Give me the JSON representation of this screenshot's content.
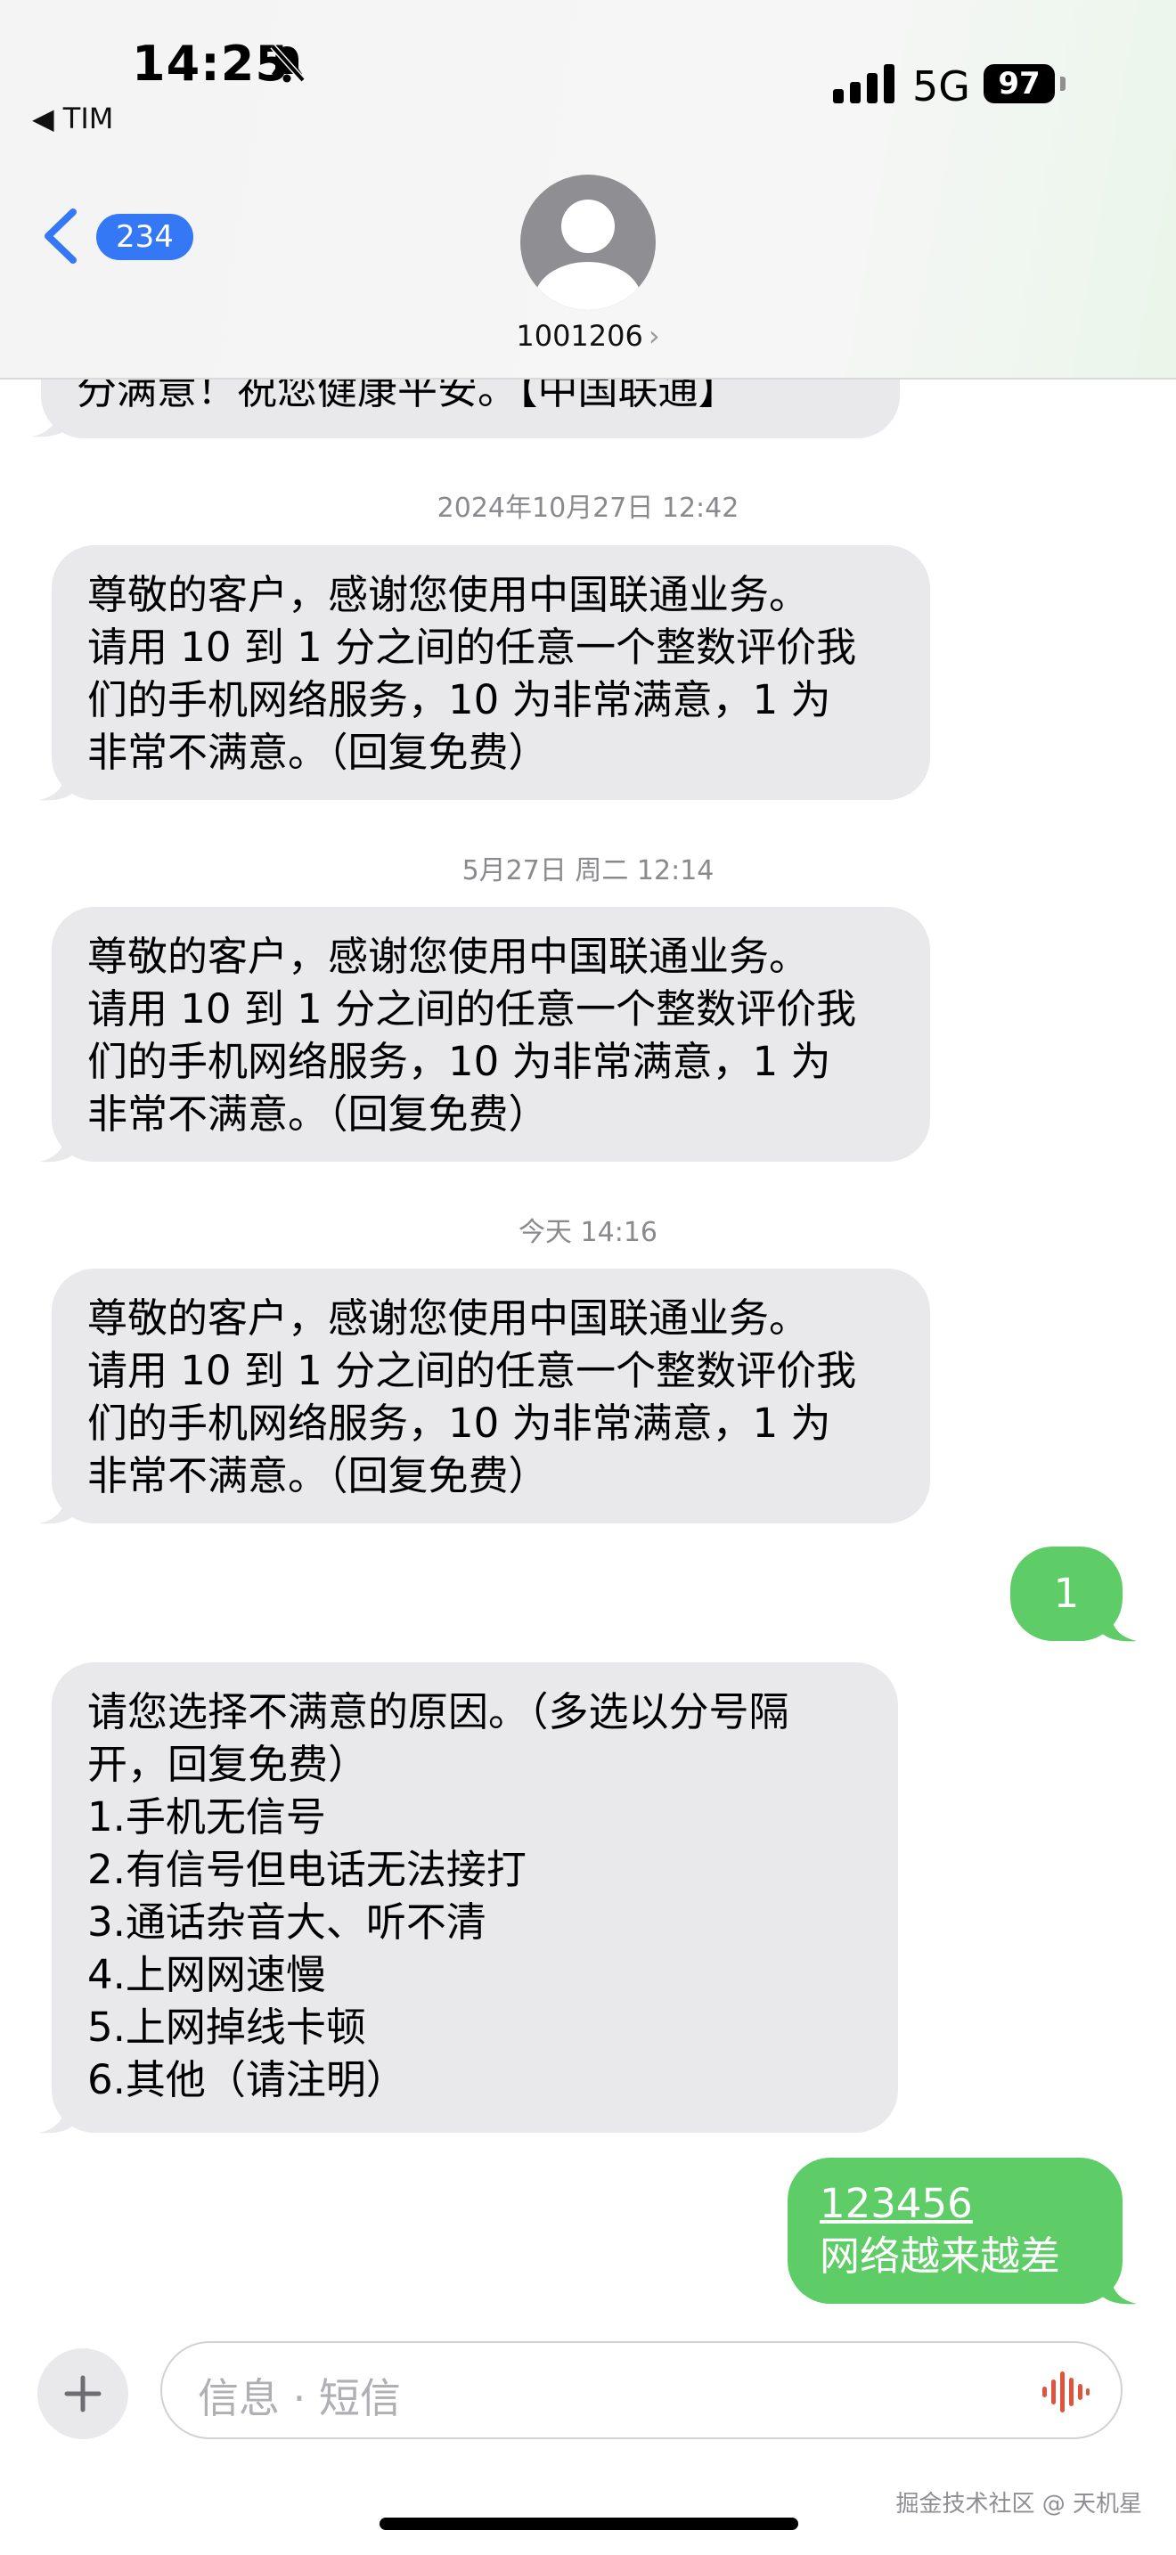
{
  "status_bar": {
    "time": "14:25",
    "carrier": "◀ TIM",
    "network": "5G",
    "battery": "97"
  },
  "nav": {
    "back_count": "234",
    "contact": "1001206",
    "contact_chevron": "›"
  },
  "messages": {
    "m0": {
      "lines": [
        "分满意！祝您健康平安。【中国联通】"
      ]
    },
    "t1": "2024年10月27日 12:42",
    "m1": {
      "lines": [
        "尊敬的客户，感谢您使用中国联通业务。",
        "请用 10 到 1 分之间的任意一个整数评价我",
        "们的手机网络服务，10 为非常满意，1 为",
        "非常不满意。（回复免费）"
      ]
    },
    "t2": "5月27日 周二 12:14",
    "m2": {
      "lines": [
        "尊敬的客户，感谢您使用中国联通业务。",
        "请用 10 到 1 分之间的任意一个整数评价我",
        "们的手机网络服务，10 为非常满意，1 为",
        "非常不满意。（回复免费）"
      ]
    },
    "t3": "今天 14:16",
    "m3": {
      "lines": [
        "尊敬的客户，感谢您使用中国联通业务。",
        "请用 10 到 1 分之间的任意一个整数评价我",
        "们的手机网络服务，10 为非常满意，1 为",
        "非常不满意。（回复免费）"
      ]
    },
    "r1": {
      "text": "1"
    },
    "m4": {
      "lines": [
        "请您选择不满意的原因。（多选以分号隔",
        "开，回复免费）",
        "1.手机无信号",
        "2.有信号但电话无法接打",
        "3.通话杂音大、听不清",
        "4.上网网速慢",
        "5.上网掉线卡顿",
        "6.其他（请注明）"
      ]
    },
    "r2": {
      "link": "123456",
      "text": "网络越来越差"
    }
  },
  "composer": {
    "placeholder": "信息 · 短信"
  },
  "watermark": "掘金技术社区 @ 天机星",
  "colors": {
    "incoming": "#e9e9eb",
    "outgoing": "#5fcd67",
    "accent": "#3478f6",
    "mic": "#e0533d"
  }
}
